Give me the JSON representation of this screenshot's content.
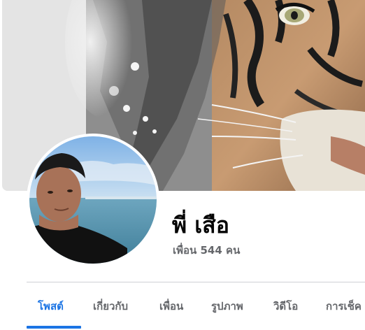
{
  "profile": {
    "name": "พี่ เสือ",
    "friends": "เพื่อน 544 คน"
  },
  "tabs": [
    {
      "label": "โพสต์",
      "active": true
    },
    {
      "label": "เกี่ยวกับ",
      "active": false
    },
    {
      "label": "เพื่อน",
      "active": false
    },
    {
      "label": "รูปภาพ",
      "active": false
    },
    {
      "label": "วิดีโอ",
      "active": false
    },
    {
      "label": "การเช็ค",
      "active": false
    }
  ],
  "colors": {
    "accent": "#1b74e4",
    "primary_text": "#050505",
    "secondary_text": "#65676b",
    "divider": "#ced0d4"
  }
}
